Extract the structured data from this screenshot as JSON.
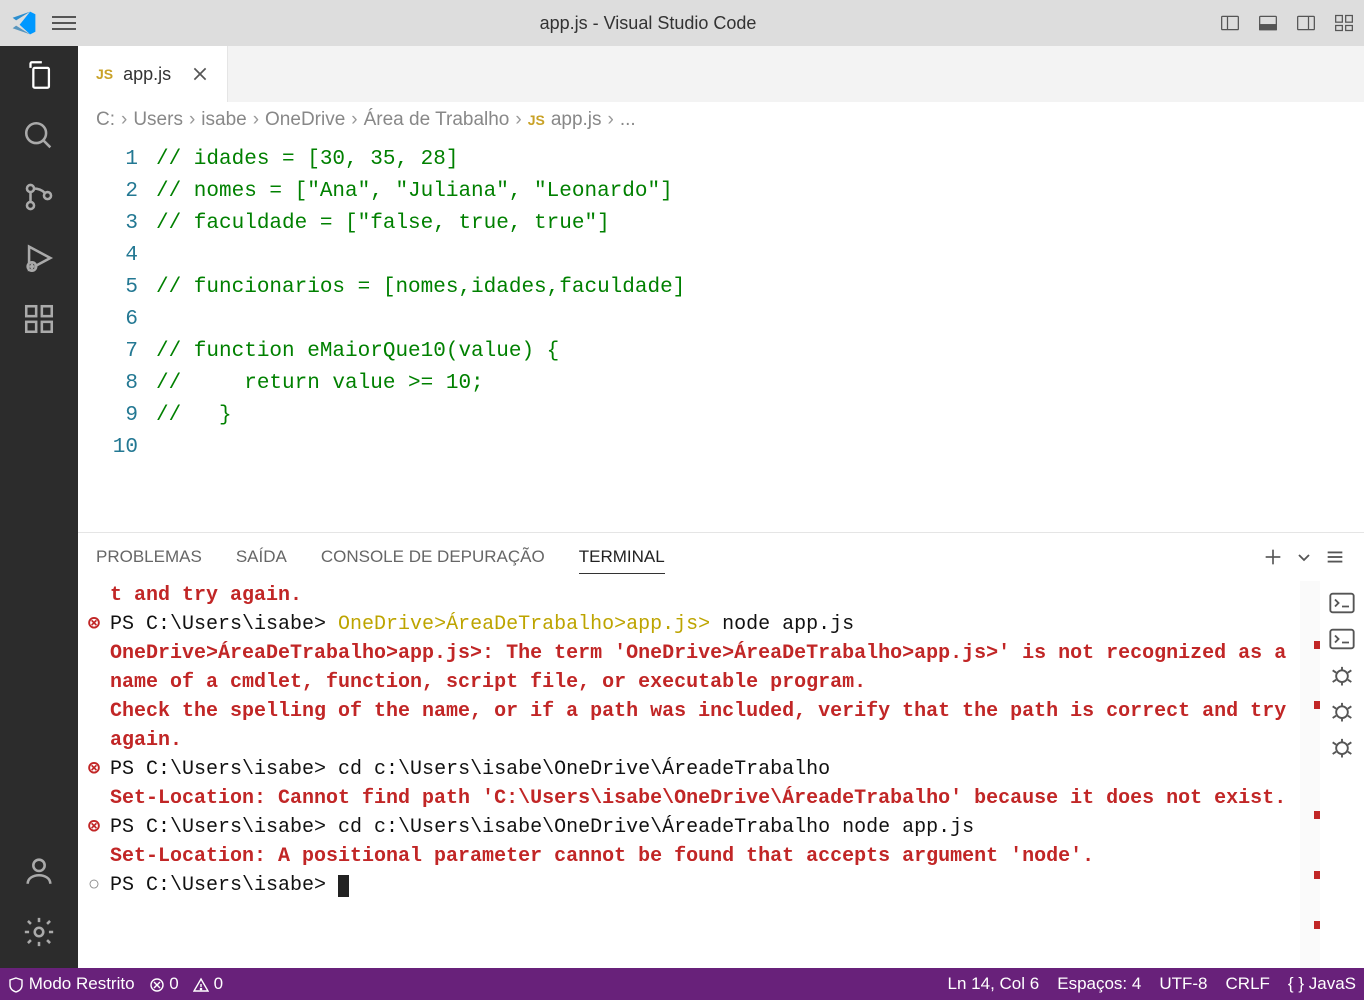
{
  "window": {
    "title": "app.js - Visual Studio Code"
  },
  "tab": {
    "icon_label": "JS",
    "name": "app.js"
  },
  "breadcrumbs": {
    "parts": [
      "C:",
      "Users",
      "isabe",
      "OneDrive",
      "Área de Trabalho"
    ],
    "file_icon": "JS",
    "file": "app.js",
    "tail": "..."
  },
  "code": {
    "lines": [
      "// idades = [30, 35, 28]",
      "// nomes = [\"Ana\", \"Juliana\", \"Leonardo\"]",
      "// faculdade = [\"false, true, true\"]",
      "",
      "// funcionarios = [nomes,idades,faculdade]",
      "",
      "// function eMaiorQue10(value) {",
      "//     return value >= 10;",
      "//   }",
      ""
    ],
    "line_numbers": [
      "1",
      "2",
      "3",
      "4",
      "5",
      "6",
      "7",
      "8",
      "9",
      "10"
    ]
  },
  "panel": {
    "tabs": {
      "problems": "PROBLEMAS",
      "output": "SAÍDA",
      "debug_console": "CONSOLE DE DEPURAÇÃO",
      "terminal": "TERMINAL"
    }
  },
  "terminal": {
    "rows": [
      {
        "icon": "",
        "cls": "err",
        "text": "t and try again."
      },
      {
        "icon": "x",
        "cls": "",
        "prompt": "PS C:\\Users\\isabe> ",
        "path": "OneDrive>ÁreaDeTrabalho>app.js>",
        "rest": " node app.js"
      },
      {
        "icon": "",
        "cls": "err",
        "text": "OneDrive>ÁreaDeTrabalho>app.js>: The term 'OneDrive>ÁreaDeTrabalho>app.js>' is not recognized as a name of a cmdlet, function, script file, or executable program."
      },
      {
        "icon": "",
        "cls": "err",
        "text": "Check the spelling of the name, or if a path was included, verify that the path is correct and try again."
      },
      {
        "icon": "x",
        "cls": "",
        "prompt": "PS C:\\Users\\isabe> ",
        "rest2": "cd c:\\Users\\isabe\\OneDrive\\ÁreadeTrabalho"
      },
      {
        "icon": "",
        "cls": "err",
        "text": "Set-Location: Cannot find path 'C:\\Users\\isabe\\OneDrive\\ÁreadeTrabalho' because it does not exist."
      },
      {
        "icon": "x",
        "cls": "",
        "prompt": "PS C:\\Users\\isabe> ",
        "rest2": "cd c:\\Users\\isabe\\OneDrive\\ÁreadeTrabalho node app.js"
      },
      {
        "icon": "",
        "cls": "err",
        "text": "Set-Location: A positional parameter cannot be found that accepts argument 'node'."
      },
      {
        "icon": "o",
        "cls": "",
        "prompt": "PS C:\\Users\\isabe> ",
        "cursor": true
      }
    ]
  },
  "statusbar": {
    "restricted": "Modo Restrito",
    "errors": "0",
    "warnings": "0",
    "cursor": "Ln 14, Col 6",
    "spaces": "Espaços: 4",
    "encoding": "UTF-8",
    "eol": "CRLF",
    "lang_brace": "{ }",
    "lang": "JavaS"
  }
}
